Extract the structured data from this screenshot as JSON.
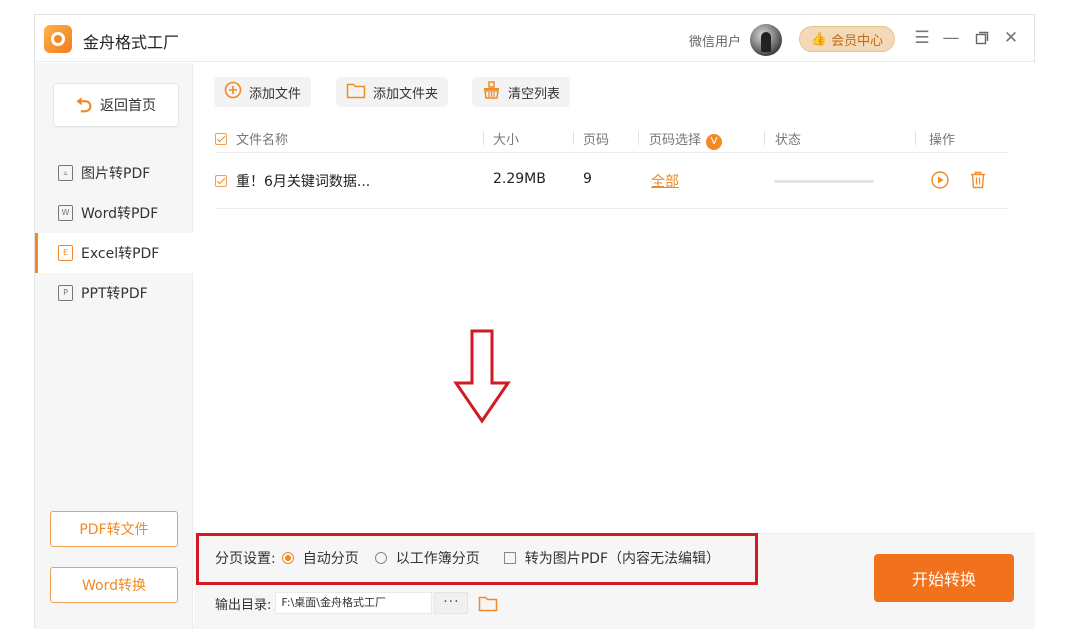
{
  "app": {
    "title": "金舟格式工厂",
    "user_name": "微信用户",
    "member_center": "会员中心",
    "window_controls": [
      "menu-icon",
      "minimize-icon",
      "maximize-icon",
      "close-icon"
    ]
  },
  "sidebar": {
    "home_label": "返回首页",
    "items": [
      {
        "label": "图片转PDF",
        "icon": "image-file-icon",
        "active": false
      },
      {
        "label": "Word转PDF",
        "icon": "word-file-icon",
        "active": false
      },
      {
        "label": "Excel转PDF",
        "icon": "excel-file-icon",
        "active": true
      },
      {
        "label": "PPT转PDF",
        "icon": "ppt-file-icon",
        "active": false
      }
    ],
    "bottom_buttons": [
      "PDF转文件",
      "Word转换"
    ]
  },
  "toolbar": {
    "add_file": "添加文件",
    "add_folder": "添加文件夹",
    "clear_list": "清空列表"
  },
  "table": {
    "columns": {
      "name": "文件名称",
      "size": "大小",
      "pages": "页码",
      "page_select": "页码选择",
      "status": "状态",
      "action": "操作"
    },
    "vip_badge": "V",
    "rows": [
      {
        "name": "重！6月关键词数据...",
        "size": "2.29MB",
        "pages": "9",
        "page_select": "全部",
        "progress": 0
      }
    ]
  },
  "bottom": {
    "page_setting_label": "分页设置:",
    "options": [
      "自动分页",
      "以工作簿分页",
      "转为图片PDF（内容无法编辑）"
    ],
    "selected_option": "自动分页",
    "output_label": "输出目录:",
    "output_path": "F:\\桌面\\金舟格式工厂",
    "browse_label": "···",
    "start_button": "开始转换"
  },
  "colors": {
    "accent": "#f08a24",
    "start_button": "#f2711c",
    "highlight_box": "#d21a24"
  }
}
